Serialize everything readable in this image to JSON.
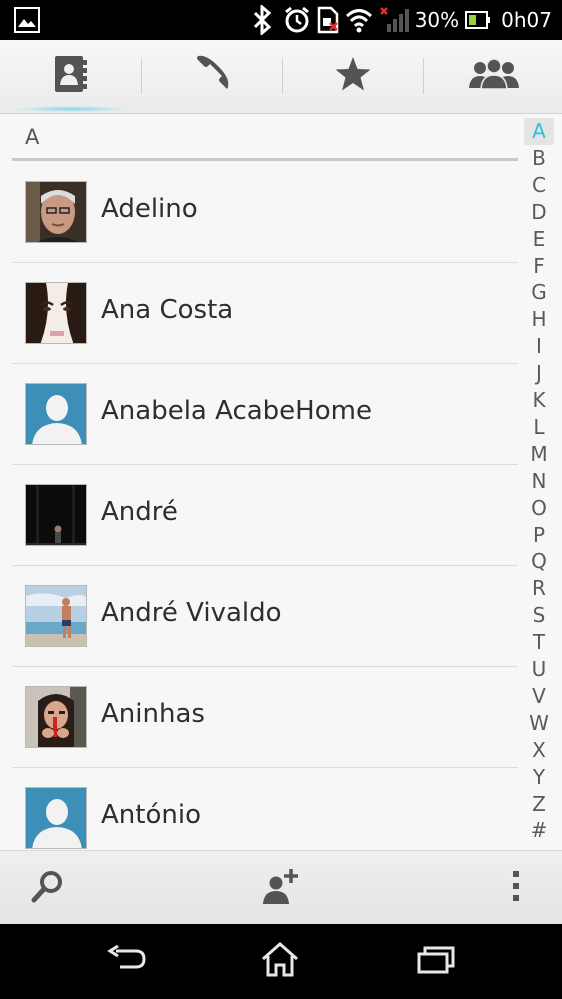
{
  "status_bar": {
    "battery_percent": "30%",
    "time": "0h07",
    "icons": [
      "gallery-icon",
      "bluetooth-icon",
      "alarm-icon",
      "sim-icon",
      "wifi-icon",
      "signal-icon",
      "battery-icon"
    ]
  },
  "tabs": [
    {
      "name": "contacts",
      "icon": "contacts-book-icon",
      "active": true
    },
    {
      "name": "phone",
      "icon": "phone-icon",
      "active": false
    },
    {
      "name": "favorites",
      "icon": "star-icon",
      "active": false
    },
    {
      "name": "groups",
      "icon": "groups-icon",
      "active": false
    }
  ],
  "list": {
    "section_letter": "A",
    "contacts": [
      {
        "name": "Adelino",
        "photo": "photo-old-man"
      },
      {
        "name": "Ana Costa",
        "photo": "photo-face-closeup"
      },
      {
        "name": "Anabela AcabeHome",
        "photo": "default-avatar"
      },
      {
        "name": "André",
        "photo": "photo-dark-stage"
      },
      {
        "name": "André Vivaldo",
        "photo": "photo-beach"
      },
      {
        "name": "Aninhas",
        "photo": "photo-girl"
      },
      {
        "name": "António",
        "photo": "default-avatar"
      }
    ]
  },
  "index_letters": [
    "A",
    "B",
    "C",
    "D",
    "E",
    "F",
    "G",
    "H",
    "I",
    "J",
    "K",
    "L",
    "M",
    "N",
    "O",
    "P",
    "Q",
    "R",
    "S",
    "T",
    "U",
    "V",
    "W",
    "X",
    "Y",
    "Z",
    "#"
  ],
  "index_active": "A",
  "colors": {
    "accent": "#2cc0dc",
    "default_avatar_bg": "#3e8fb8"
  },
  "action_bar": {
    "icons": [
      "search-icon",
      "add-contact-icon",
      "overflow-menu-icon"
    ]
  },
  "nav_bar": {
    "icons": [
      "back-icon",
      "home-icon",
      "recent-apps-icon"
    ]
  }
}
